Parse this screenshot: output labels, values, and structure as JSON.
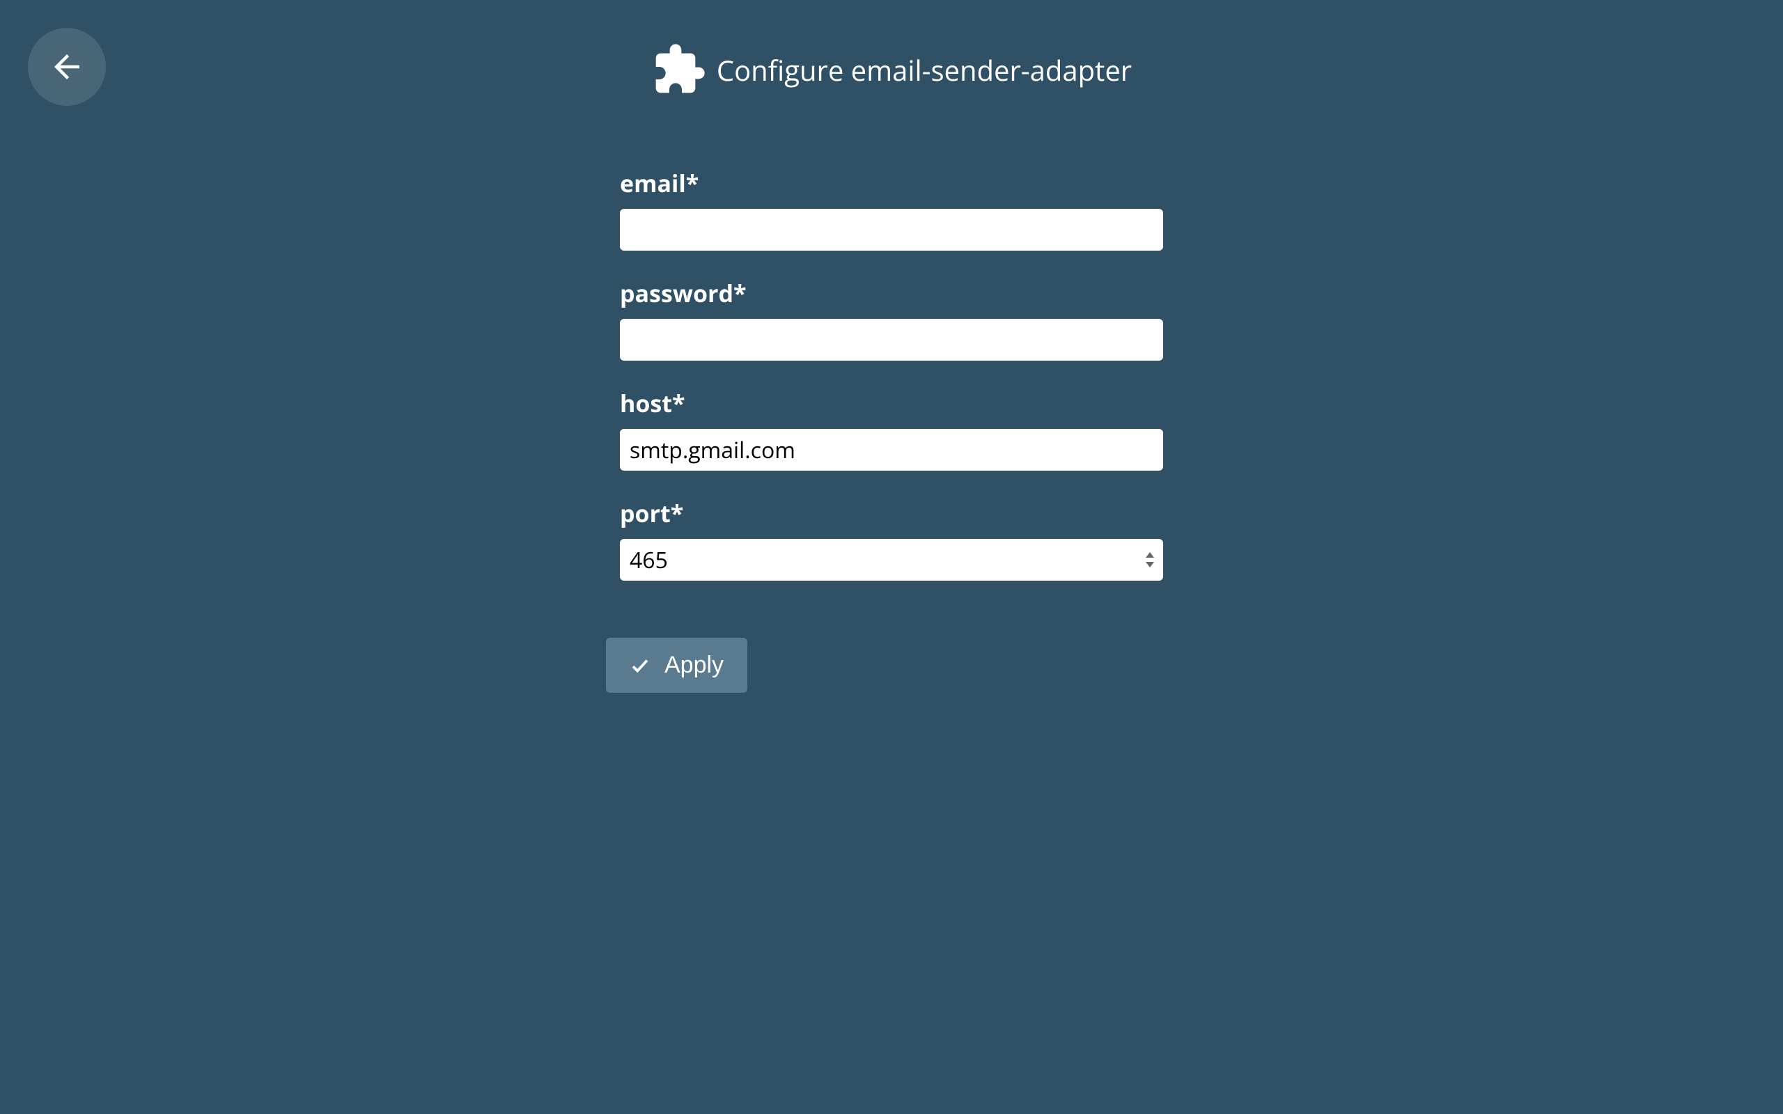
{
  "header": {
    "title": "Configure email-sender-adapter"
  },
  "form": {
    "fields": {
      "email": {
        "label": "email*",
        "value": ""
      },
      "password": {
        "label": "password*",
        "value": ""
      },
      "host": {
        "label": "host*",
        "value": "smtp.gmail.com"
      },
      "port": {
        "label": "port*",
        "value": "465"
      }
    },
    "apply_label": "Apply"
  }
}
